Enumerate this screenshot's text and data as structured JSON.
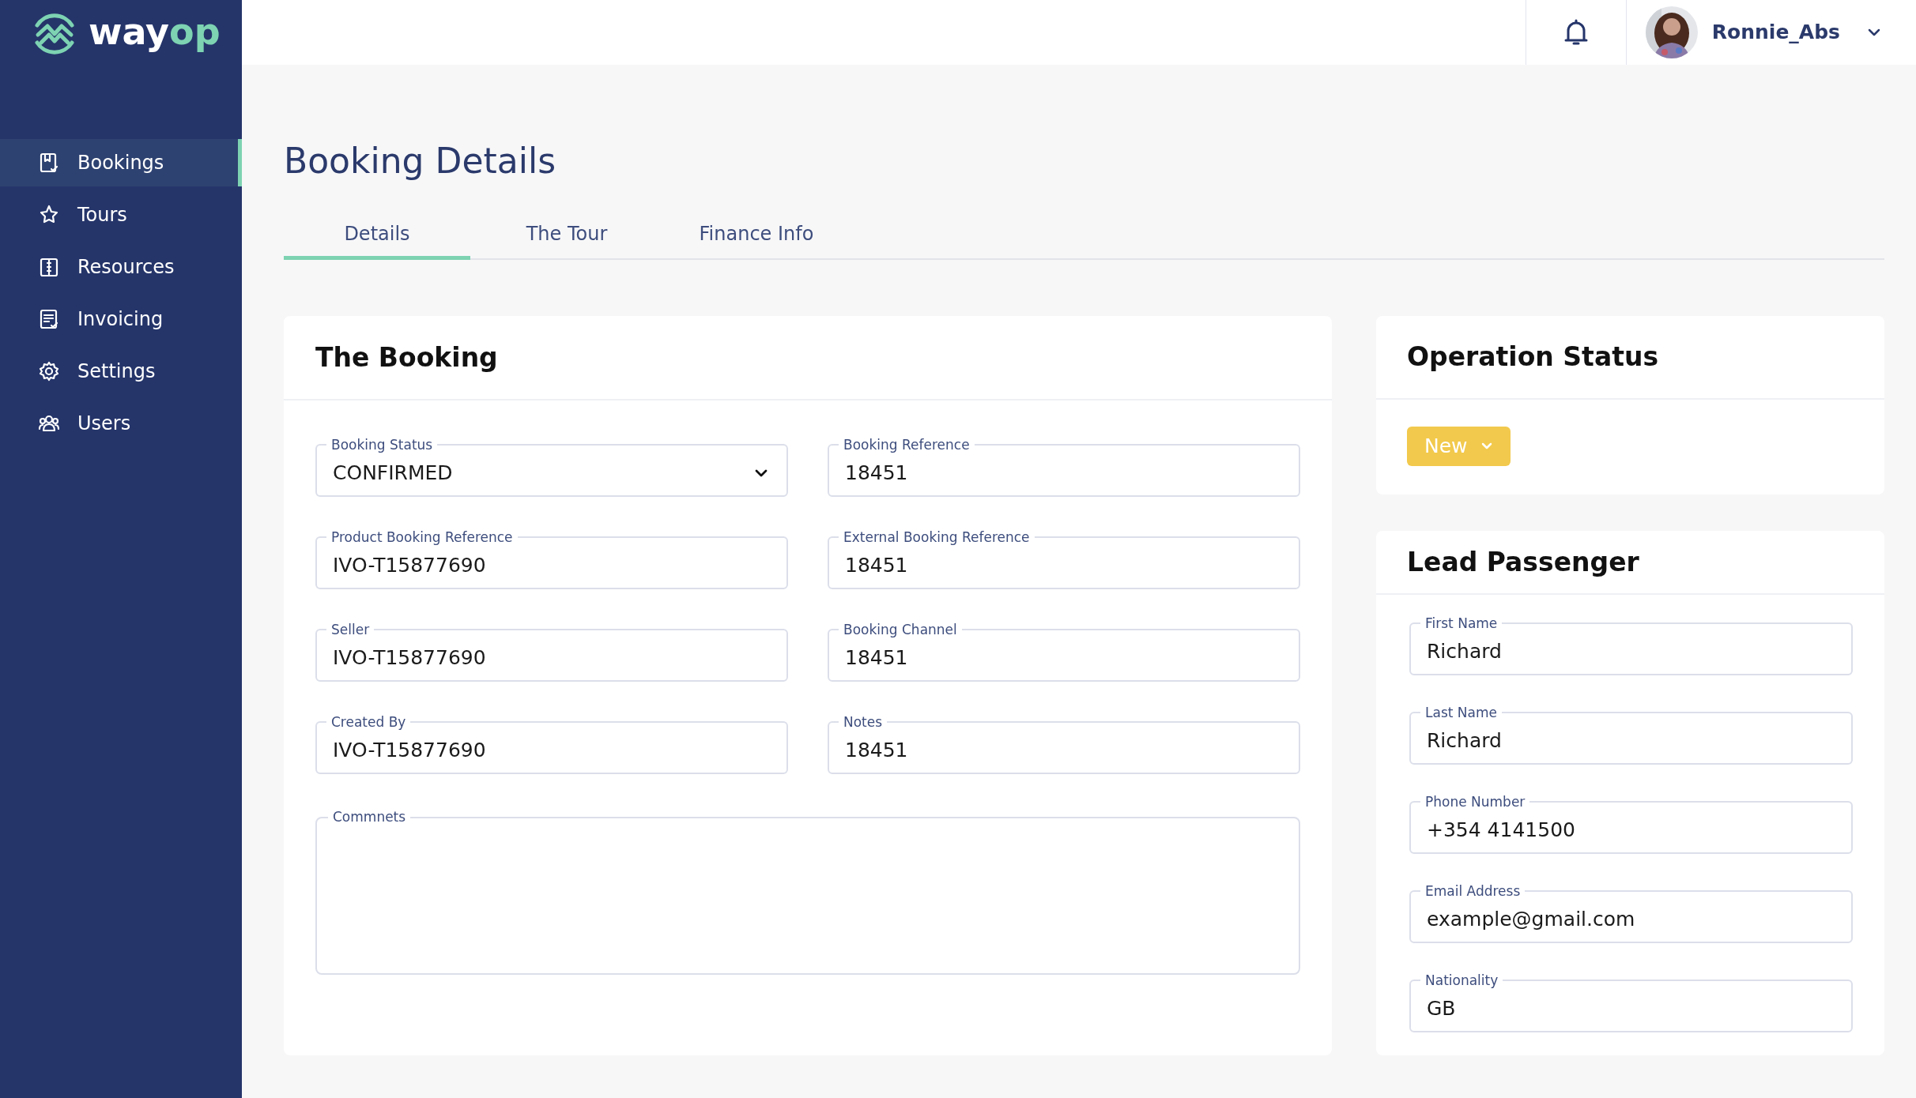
{
  "logo": {
    "text_light": "way",
    "text_accent": "op"
  },
  "sidebar": {
    "items": [
      {
        "label": "Bookings",
        "selected": true
      },
      {
        "label": "Tours",
        "selected": false
      },
      {
        "label": "Resources",
        "selected": false
      },
      {
        "label": "Invoicing",
        "selected": false
      },
      {
        "label": "Settings",
        "selected": false
      },
      {
        "label": "Users",
        "selected": false
      }
    ]
  },
  "header": {
    "user": {
      "name": "Ronnie_Abs"
    }
  },
  "page_title": "Booking Details",
  "tabs": [
    {
      "label": "Details",
      "selected": true
    },
    {
      "label": "The Tour",
      "selected": false
    },
    {
      "label": "Finance Info",
      "selected": false
    }
  ],
  "booking_card": {
    "title": "The Booking",
    "fields": [
      {
        "kind": "dropdown",
        "label": "Booking Status",
        "value": "CONFIRMED"
      },
      {
        "kind": "text",
        "label": "Booking Reference",
        "value": "18451"
      },
      {
        "kind": "text",
        "label": "Product Booking Reference",
        "value": "IVO-T15877690"
      },
      {
        "kind": "text",
        "label": "External Booking Reference",
        "value": "18451"
      },
      {
        "kind": "text",
        "label": "Seller",
        "value": "IVO-T15877690"
      },
      {
        "kind": "text",
        "label": "Booking Channel",
        "value": "18451"
      },
      {
        "kind": "text",
        "label": "Created By",
        "value": "IVO-T15877690"
      },
      {
        "kind": "text",
        "label": "Notes",
        "value": "18451"
      }
    ],
    "comments_field": {
      "label": "Commnets"
    }
  },
  "operation_status": {
    "title": "Operation Status",
    "status_button": {
      "label": "New"
    }
  },
  "lead_passenger": {
    "title": "Lead Passenger",
    "fields": [
      {
        "kind": "text",
        "label": "First Name",
        "value": "Richard"
      },
      {
        "kind": "text",
        "label": "Last Name",
        "value": "Richard"
      },
      {
        "kind": "text",
        "label": "Phone Number",
        "value": "+354 4141500"
      },
      {
        "kind": "text",
        "label": "Email Address",
        "value": "example@gmail.com"
      },
      {
        "kind": "text",
        "label": "Nationality",
        "value": "GB"
      }
    ]
  }
}
